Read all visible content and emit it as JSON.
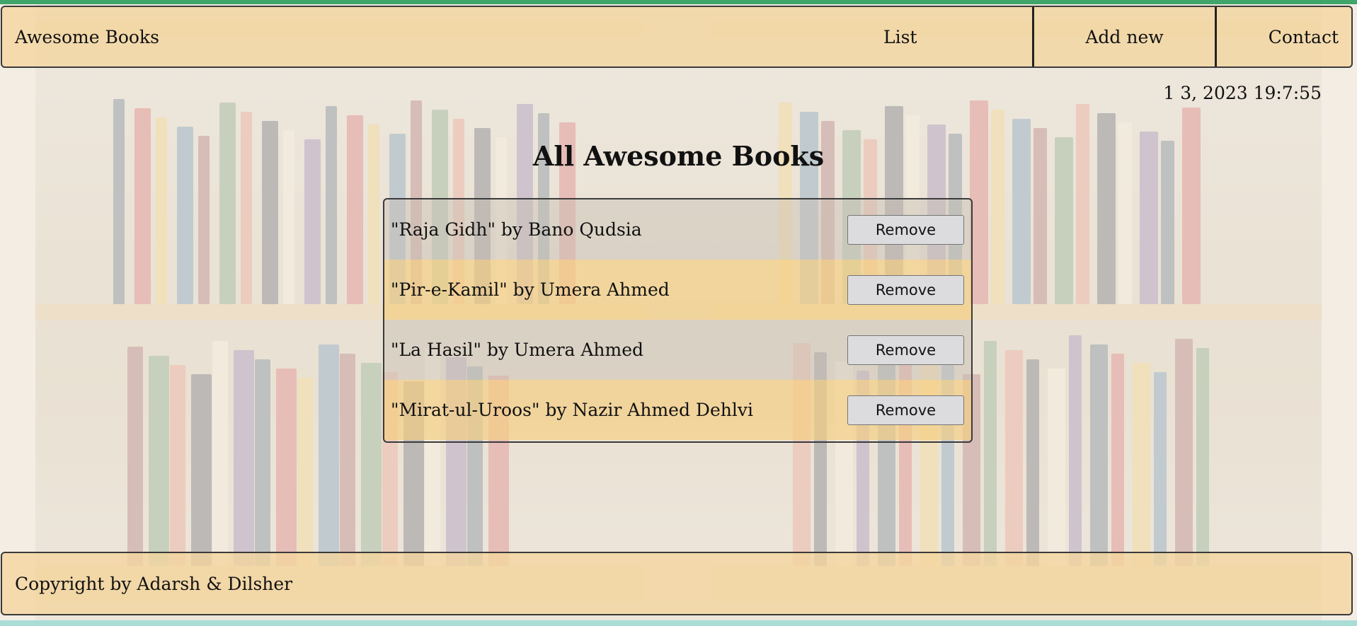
{
  "header": {
    "brand": "Awesome Books",
    "nav": [
      {
        "label": "List"
      },
      {
        "label": "Add new"
      },
      {
        "label": "Contact"
      }
    ]
  },
  "datetime": "1 3, 2023 19:7:55",
  "main": {
    "title": "All Awesome Books",
    "books": [
      {
        "text": "\"Raja Gidh\" by Bano Qudsia",
        "button": "Remove"
      },
      {
        "text": "\"Pir-e-Kamil\" by Umera Ahmed",
        "button": "Remove"
      },
      {
        "text": "\"La Hasil\" by Umera Ahmed",
        "button": "Remove"
      },
      {
        "text": "\"Mirat-ul-Uroos\" by Nazir Ahmed Dehlvi",
        "button": "Remove"
      }
    ]
  },
  "footer": {
    "text": "Copyright by Adarsh & Dilsher"
  },
  "colors": {
    "panel": "#f4d59e",
    "border": "#3a3a3a",
    "top_strip": "#3fa56a",
    "bottom_strip": "#a9ddd6"
  }
}
